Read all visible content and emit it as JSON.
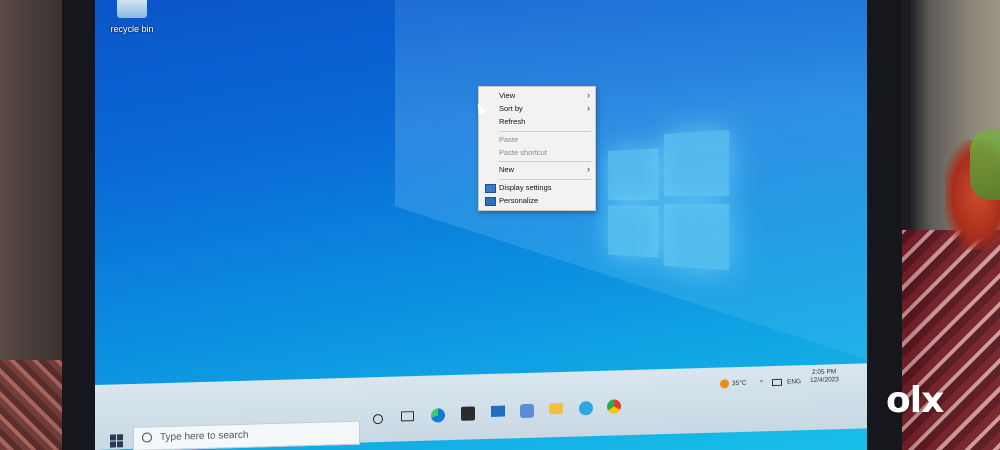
{
  "desktop": {
    "icon_label": "recycle bin"
  },
  "context_menu": {
    "items": [
      {
        "label": "View",
        "submenu": true,
        "enabled": true
      },
      {
        "label": "Sort by",
        "submenu": true,
        "enabled": true
      },
      {
        "label": "Refresh",
        "submenu": false,
        "enabled": true
      },
      {
        "label": "Paste",
        "submenu": false,
        "enabled": false
      },
      {
        "label": "Paste shortcut",
        "submenu": false,
        "enabled": false
      },
      {
        "label": "New",
        "submenu": true,
        "enabled": true
      },
      {
        "label": "Display settings",
        "submenu": false,
        "enabled": true,
        "icon": "display-icon"
      },
      {
        "label": "Personalize",
        "submenu": false,
        "enabled": true,
        "icon": "personalize-icon"
      }
    ]
  },
  "taskbar": {
    "search_placeholder": "Type here to search",
    "pinned": [
      "cortana-icon",
      "task-view-icon",
      "edge-icon",
      "store-icon",
      "mail-icon",
      "chat-icon",
      "folder-icon",
      "telegram-icon",
      "chrome-icon"
    ],
    "tray": {
      "weather": "35°C",
      "language": "ENG",
      "time": "2:05 PM",
      "date": "12/4/2023"
    }
  },
  "watermark": "olx",
  "colors": {
    "desktop_top": "#0b55c9",
    "desktop_bottom": "#18c0e8",
    "menu_bg": "#f2f2f2",
    "taskbar_bg": "#d9e6ef"
  }
}
